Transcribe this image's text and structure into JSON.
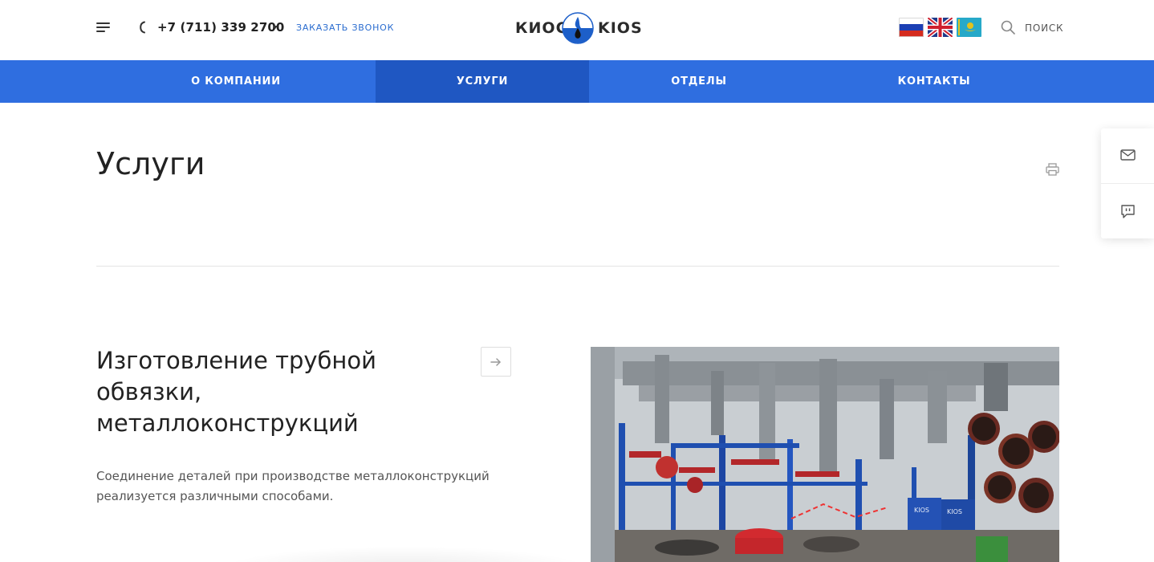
{
  "header": {
    "phone": "+7 (711) 339 2700",
    "callback_label": "ЗАКАЗАТЬ ЗВОНОК",
    "logo_left": "КИОС",
    "logo_right": "KIOS",
    "search_label": "ПОИСК",
    "languages": [
      "ru-flag-icon",
      "gb-flag-icon",
      "kz-flag-icon"
    ]
  },
  "nav": {
    "items": [
      {
        "label": "О КОМПАНИИ",
        "active": false
      },
      {
        "label": "УСЛУГИ",
        "active": true
      },
      {
        "label": "ОТДЕЛЫ",
        "active": false
      },
      {
        "label": "КОНТАКТЫ",
        "active": false
      }
    ]
  },
  "page": {
    "title": "Услуги"
  },
  "service": {
    "title": "Изготовление трубной обвязки, металлоконструкций",
    "description": "Соединение деталей при производстве металлоконструкций реализуется различными способами.",
    "photo_labels": [
      "KIOS",
      "KIOS"
    ]
  },
  "colors": {
    "nav_bg": "#2f6ee0",
    "nav_active": "#1f57c2",
    "accent_link": "#2a6ccf",
    "text": "#222222"
  },
  "icons": {
    "menu": "burger-menu-icon",
    "phone": "phone-icon",
    "search": "search-icon",
    "print": "print-icon",
    "mail": "mail-icon",
    "feedback": "feedback-icon",
    "next": "arrow-right-icon"
  }
}
